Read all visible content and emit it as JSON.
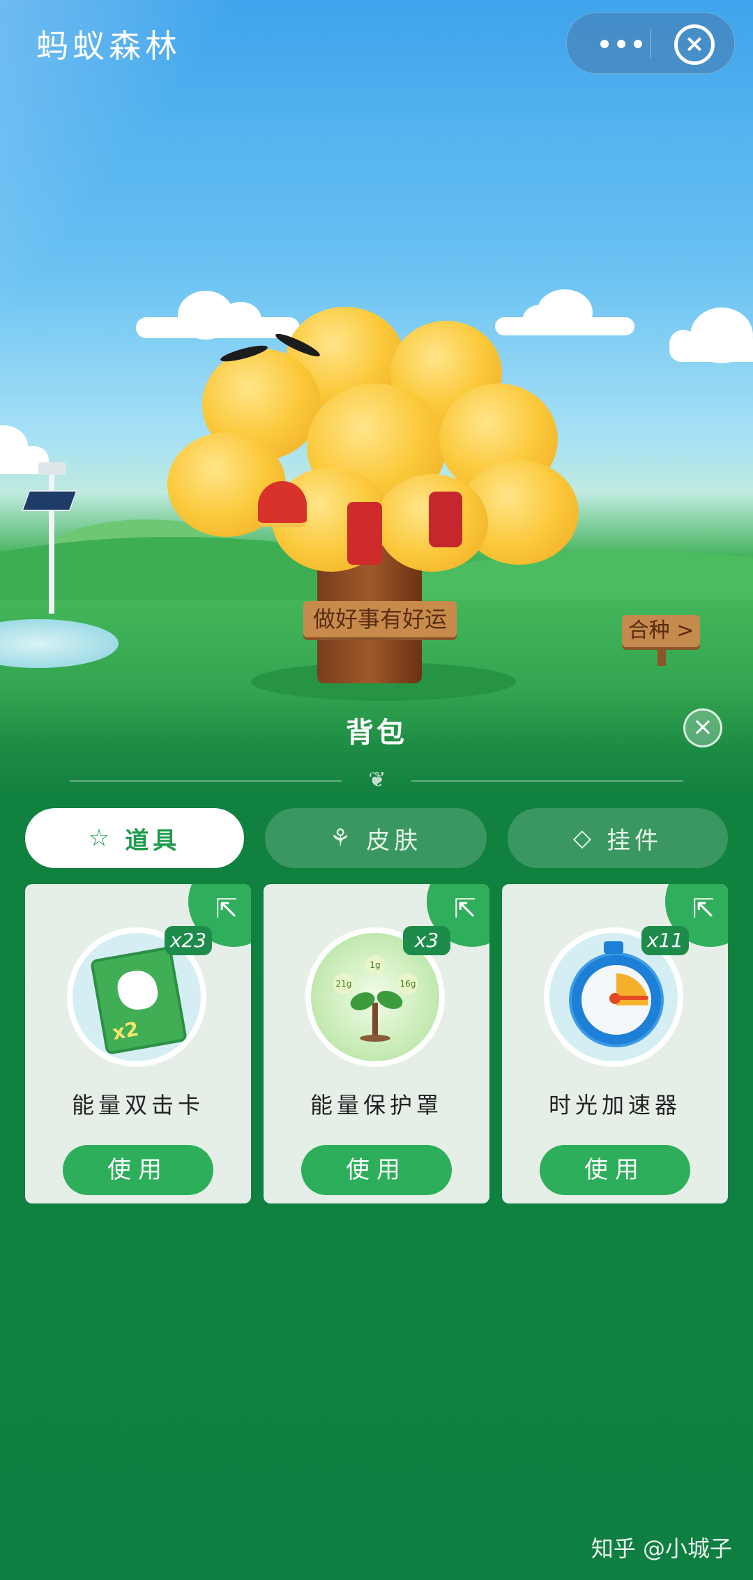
{
  "header": {
    "app_title": "蚂蚁森林"
  },
  "scene": {
    "tree_sign": "做好事有好运",
    "right_sign": "合种 >"
  },
  "backpack": {
    "title": "背包",
    "tabs": [
      {
        "label": "道具",
        "icon": "star-icon",
        "active": true
      },
      {
        "label": "皮肤",
        "icon": "tree-icon",
        "active": false
      },
      {
        "label": "挂件",
        "icon": "pendant-icon",
        "active": false
      }
    ],
    "items": [
      {
        "name": "能量双击卡",
        "count": "x23",
        "button": "使用",
        "icon": "double-hit-card-icon",
        "card_text": "x2"
      },
      {
        "name": "能量保护罩",
        "count": "x3",
        "button": "使用",
        "icon": "energy-shield-icon",
        "bubbles": [
          "21g",
          "1g",
          "16g"
        ]
      },
      {
        "name": "时光加速器",
        "count": "x11",
        "button": "使用",
        "icon": "stopwatch-icon"
      }
    ]
  },
  "watermark": "知乎 @小城子",
  "colors": {
    "primary_green": "#2dae5a",
    "dark_green": "#0f7f41",
    "sign_wood": "#c88b4c"
  }
}
